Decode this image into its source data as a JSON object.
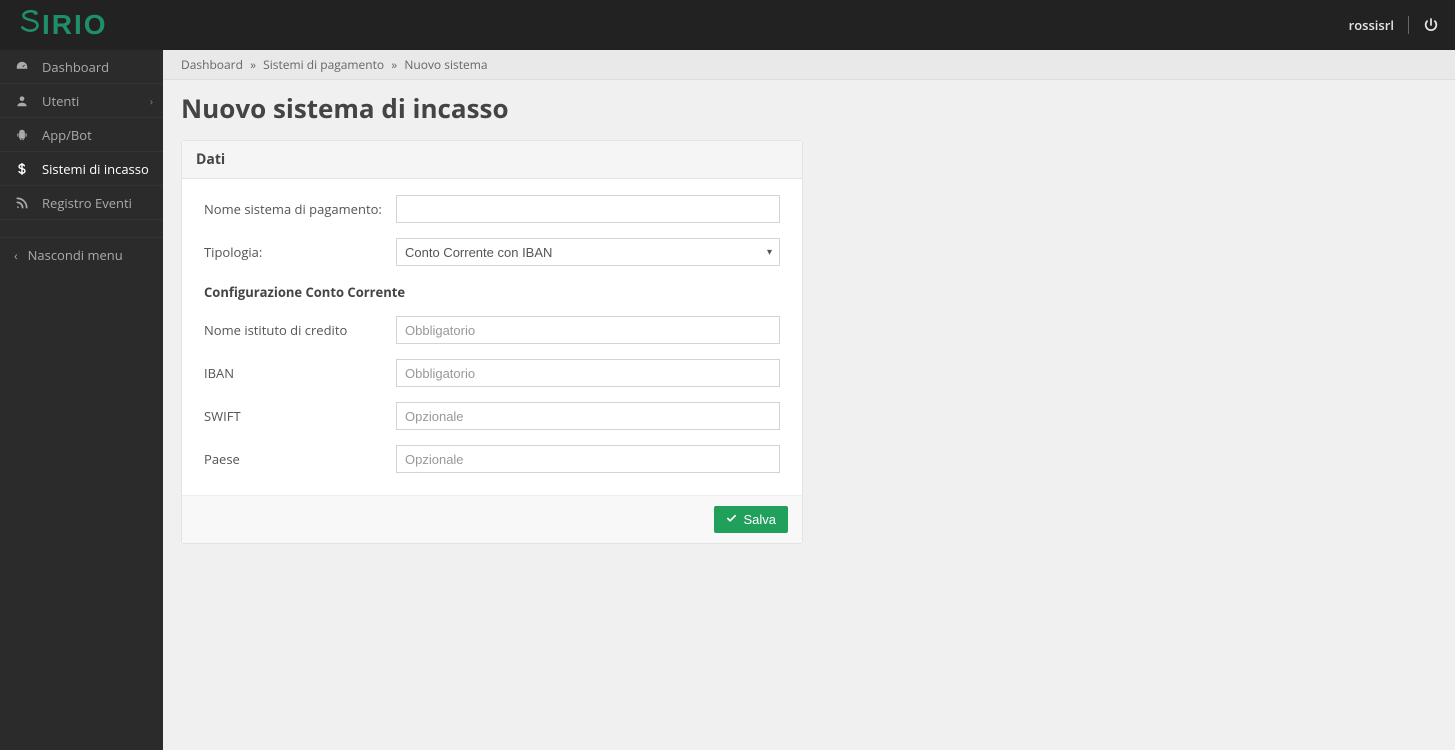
{
  "brand": "SIRIO",
  "header": {
    "username": "rossisrl"
  },
  "sidebar": {
    "items": [
      {
        "label": "Dashboard"
      },
      {
        "label": "Utenti"
      },
      {
        "label": "App/Bot"
      },
      {
        "label": "Sistemi di incasso"
      },
      {
        "label": "Registro Eventi"
      }
    ],
    "collapse": "Nascondi menu"
  },
  "breadcrumb": {
    "items": [
      "Dashboard",
      "Sistemi di pagamento",
      "Nuovo sistema"
    ]
  },
  "page": {
    "title": "Nuovo sistema di incasso"
  },
  "panel": {
    "title": "Dati",
    "save": "Salva"
  },
  "form": {
    "nome_label": "Nome sistema di pagamento:",
    "nome_value": "",
    "tipologia_label": "Tipologia:",
    "tipologia_value": "Conto Corrente con IBAN",
    "conf_header": "Configurazione Conto Corrente",
    "istituto_label": "Nome istituto di credito",
    "istituto_placeholder": "Obbligatorio",
    "istituto_value": "",
    "iban_label": "IBAN",
    "iban_placeholder": "Obbligatorio",
    "iban_value": "",
    "swift_label": "SWIFT",
    "swift_placeholder": "Opzionale",
    "swift_value": "",
    "paese_label": "Paese",
    "paese_placeholder": "Opzionale",
    "paese_value": ""
  }
}
